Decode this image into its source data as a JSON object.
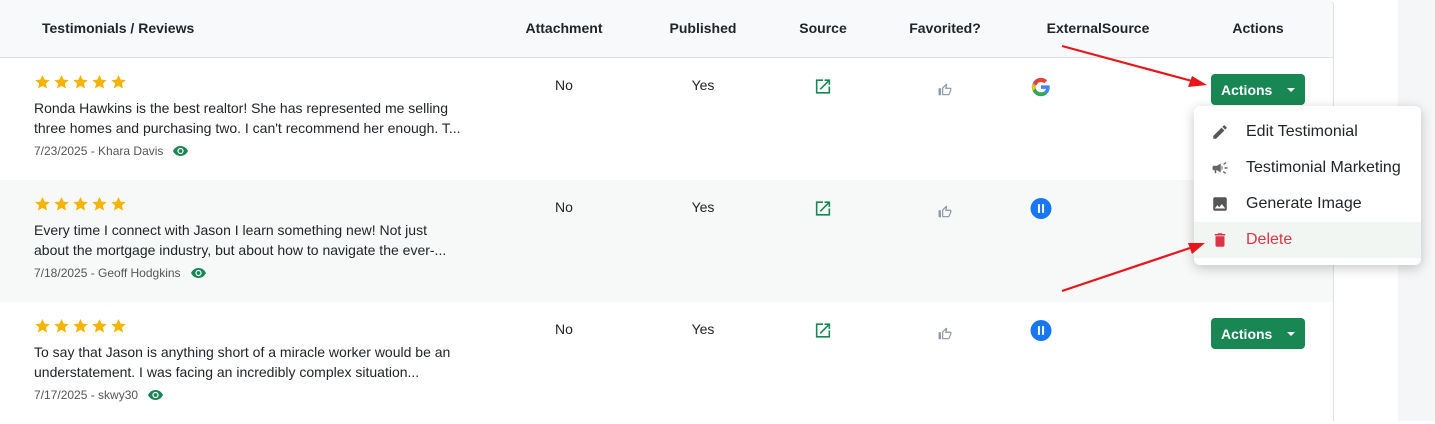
{
  "headers": {
    "review": "Testimonials / Reviews",
    "attachment": "Attachment",
    "published": "Published",
    "source": "Source",
    "favorited": "Favorited?",
    "external": "ExternalSource",
    "actions": "Actions"
  },
  "rows": [
    {
      "stars": 5,
      "line1": "Ronda Hawkins is the best realtor! She has represented me selling",
      "line2": "three homes and purchasing two. I can't recommend her enough. T...",
      "meta": "7/23/2025 - Khara Davis",
      "attachment": "No",
      "published": "Yes",
      "external_icon": "google-icon"
    },
    {
      "stars": 5,
      "line1": "Every time I connect with Jason I learn something new! Not just",
      "line2": "about the mortgage industry, but about how to navigate the ever-...",
      "meta": "7/18/2025 - Geoff Hodgkins",
      "attachment": "No",
      "published": "Yes",
      "external_icon": "pause-circle-icon"
    },
    {
      "stars": 5,
      "line1": "To say that Jason is anything short of a miracle worker would be an",
      "line2": "understatement. I was facing an incredibly complex situation...",
      "meta": "7/17/2025 - skwy30",
      "attachment": "No",
      "published": "Yes",
      "external_icon": "pause-circle-icon"
    }
  ],
  "actions_button": {
    "label": "Actions"
  },
  "menu": {
    "items": [
      {
        "label": "Edit Testimonial",
        "icon": "pencil-icon"
      },
      {
        "label": "Testimonial Marketing",
        "icon": "megaphone-icon"
      },
      {
        "label": "Generate Image",
        "icon": "image-icon"
      },
      {
        "label": "Delete",
        "icon": "trash-icon"
      }
    ]
  },
  "colors": {
    "brand_green": "#198754",
    "star": "#f5b400",
    "danger": "#dc3545",
    "annotation_arrow": "#e8151b",
    "google_blue": "#4285f4",
    "pause_blue": "#1877f2"
  }
}
